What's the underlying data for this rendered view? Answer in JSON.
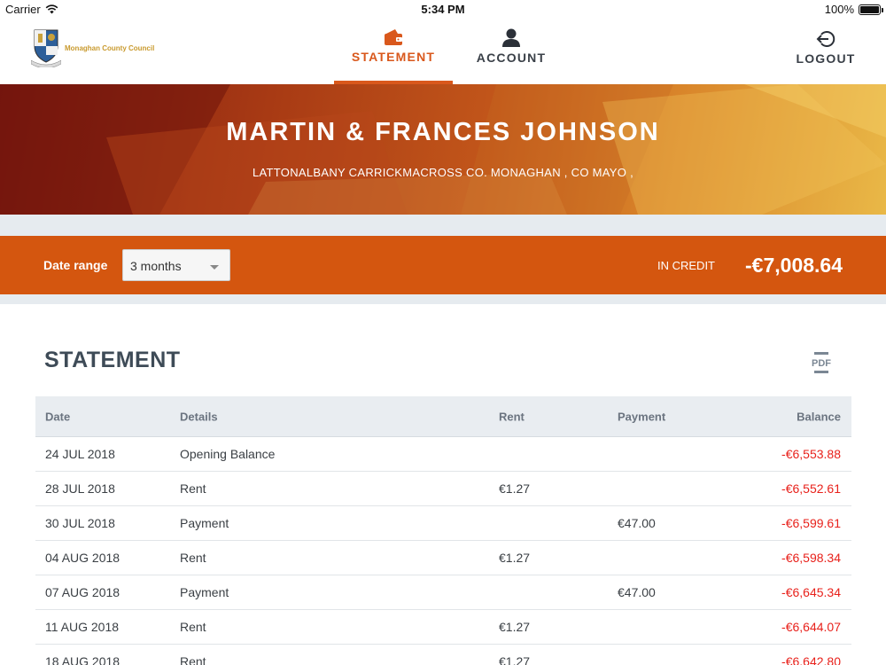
{
  "status_bar": {
    "carrier": "Carrier",
    "time": "5:34 PM",
    "battery": "100%"
  },
  "header": {
    "logo_text": "Monaghan County Council",
    "nav": {
      "statement": "STATEMENT",
      "account": "ACCOUNT",
      "logout": "LOGOUT"
    },
    "active_tab": "statement"
  },
  "banner": {
    "name": "MARTIN & FRANCES JOHNSON",
    "address": "LATTONALBANY CARRICKMACROSS CO. MONAGHAN , CO MAYO ,"
  },
  "range_bar": {
    "date_range_label": "Date range",
    "date_range_value": "3 months",
    "credit_label": "IN CREDIT",
    "credit_value": "-€7,008.64"
  },
  "statement": {
    "title": "STATEMENT",
    "pdf_label": "PDF",
    "columns": {
      "date": "Date",
      "details": "Details",
      "rent": "Rent",
      "payment": "Payment",
      "balance": "Balance"
    },
    "rows": [
      {
        "date": "24 JUL 2018",
        "details": "Opening Balance",
        "rent": "",
        "payment": "",
        "balance": "-€6,553.88"
      },
      {
        "date": "28 JUL 2018",
        "details": "Rent",
        "rent": "€1.27",
        "payment": "",
        "balance": "-€6,552.61"
      },
      {
        "date": "30 JUL 2018",
        "details": "Payment",
        "rent": "",
        "payment": "€47.00",
        "balance": "-€6,599.61"
      },
      {
        "date": "04 AUG 2018",
        "details": "Rent",
        "rent": "€1.27",
        "payment": "",
        "balance": "-€6,598.34"
      },
      {
        "date": "07 AUG 2018",
        "details": "Payment",
        "rent": "",
        "payment": "€47.00",
        "balance": "-€6,645.34"
      },
      {
        "date": "11 AUG 2018",
        "details": "Rent",
        "rent": "€1.27",
        "payment": "",
        "balance": "-€6,644.07"
      },
      {
        "date": "18 AUG 2018",
        "details": "Rent",
        "rent": "€1.27",
        "payment": "",
        "balance": "-€6,642.80"
      }
    ]
  },
  "colors": {
    "accent": "#d4560f",
    "negative": "#e8211b",
    "heading": "#3e4b57",
    "table_header_bg": "#e9edf1"
  },
  "icons": {
    "statement": "wallet-icon",
    "account": "user-icon",
    "logout": "logout-icon",
    "pdf": "pdf-icon",
    "dropdown": "chevron-down-icon"
  }
}
